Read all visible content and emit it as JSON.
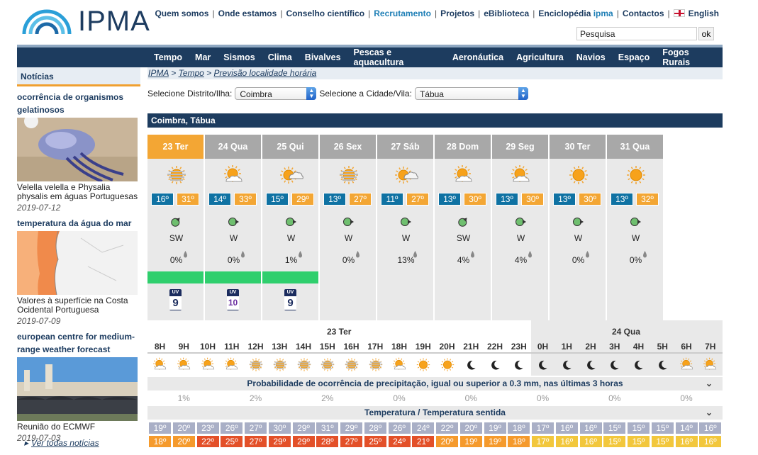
{
  "header": {
    "logo_text": "IPMA",
    "top_links": [
      "Quem somos",
      "Onde estamos",
      "Conselho científico",
      "Recrutamento",
      "Projetos",
      "eBiblioteca",
      "Enciclopédia ",
      "Contactos"
    ],
    "enciclopedia_suffix": "ipma",
    "english_label": "English",
    "search_placeholder": "Pesquisa",
    "search_value": "Pesquisa",
    "ok_label": "ok"
  },
  "main_nav": [
    "Tempo",
    "Mar",
    "Sismos",
    "Clima",
    "Bivalves",
    "Pescas e aquacultura",
    "Aeronáutica",
    "Agricultura",
    "Navios",
    "Espaço",
    "Fogos Rurais"
  ],
  "news": {
    "header": "Notícias",
    "items": [
      {
        "title": "ocorrência de organismos gelatinosos",
        "caption": "Velella velella e Physalia physalis em águas Portuguesas",
        "date": "2019-07-12"
      },
      {
        "title": "temperatura da água do mar",
        "caption": "Valores à superfície na Costa Ocidental Portuguesa",
        "date": "2019-07-09"
      },
      {
        "title": "european centre for medium-range weather forecast",
        "caption": "Reunião do ECMWF",
        "date": "2019-07-03"
      }
    ],
    "all_news": "Ver todas notícias"
  },
  "breadcrumb": {
    "ipma": "IPMA",
    "sep1": " > ",
    "tempo": "Tempo",
    "sep2": " > ",
    "current": "Previsão localidade horária"
  },
  "selectors": {
    "distrito_label": "Selecione Distrito/Ilha:",
    "distrito_value": "Coimbra",
    "cidade_label": "Selecione a Cidade/Vila:",
    "cidade_value": "Tábua"
  },
  "location_title": "Coimbra, Tábua",
  "days": [
    {
      "label": "23 Ter",
      "icon": "haze-sun",
      "tmin": "16º",
      "tmax": "31º",
      "wind": "SW",
      "prob": "0%",
      "green": true,
      "uv": "9",
      "uv_color": "#1b2c5e"
    },
    {
      "label": "24 Qua",
      "icon": "sun-cloud",
      "tmin": "14º",
      "tmax": "33º",
      "wind": "W",
      "prob": "0%",
      "green": true,
      "uv": "10",
      "uv_color": "#6b2fa0"
    },
    {
      "label": "25 Qui",
      "icon": "sun-cloud-big",
      "tmin": "15º",
      "tmax": "29º",
      "wind": "W",
      "prob": "1%",
      "green": true,
      "uv": "9",
      "uv_color": "#1b2c5e"
    },
    {
      "label": "26 Sex",
      "icon": "haze-sun",
      "tmin": "13º",
      "tmax": "27º",
      "wind": "W",
      "prob": "0%",
      "green": false,
      "uv": "",
      "uv_color": ""
    },
    {
      "label": "27 Sáb",
      "icon": "sun-cloud-big",
      "tmin": "11º",
      "tmax": "27º",
      "wind": "W",
      "prob": "13%",
      "green": false,
      "uv": "",
      "uv_color": ""
    },
    {
      "label": "28 Dom",
      "icon": "sun-cloud",
      "tmin": "13º",
      "tmax": "30º",
      "wind": "SW",
      "prob": "4%",
      "green": false,
      "uv": "",
      "uv_color": ""
    },
    {
      "label": "29 Seg",
      "icon": "sun-cloud",
      "tmin": "13º",
      "tmax": "30º",
      "wind": "W",
      "prob": "4%",
      "green": false,
      "uv": "",
      "uv_color": ""
    },
    {
      "label": "30 Ter",
      "icon": "sun",
      "tmin": "13º",
      "tmax": "30º",
      "wind": "W",
      "prob": "0%",
      "green": false,
      "uv": "",
      "uv_color": ""
    },
    {
      "label": "31 Qua",
      "icon": "sun",
      "tmin": "13º",
      "tmax": "32º",
      "wind": "W",
      "prob": "0%",
      "green": false,
      "uv": "",
      "uv_color": ""
    }
  ],
  "hourly": {
    "date1": "23 Ter",
    "date2": "24 Qua",
    "hours": [
      "8H",
      "9H",
      "10H",
      "11H",
      "12H",
      "13H",
      "14H",
      "15H",
      "16H",
      "17H",
      "18H",
      "19H",
      "20H",
      "21H",
      "22H",
      "23H",
      "0H",
      "1H",
      "2H",
      "3H",
      "4H",
      "5H",
      "6H",
      "7H"
    ],
    "icons": [
      "sun-cloud",
      "sun-cloud",
      "sun-cloud",
      "sun-cloud",
      "haze-sun",
      "haze-sun",
      "haze-sun",
      "haze-sun",
      "haze-sun",
      "haze-sun",
      "sun-cloud",
      "sun",
      "sun",
      "moon",
      "moon",
      "moon",
      "moon",
      "moon",
      "moon",
      "moon",
      "moon",
      "moon",
      "sun-cloud",
      "sun-cloud"
    ],
    "precip_title": "Probabilidade de ocorrência de precipitação, igual ou superior a 0.3 mm, nas últimas 3 horas",
    "precip": [
      {
        "col": 1,
        "v": "1%"
      },
      {
        "col": 4,
        "v": "2%"
      },
      {
        "col": 7,
        "v": "2%"
      },
      {
        "col": 10,
        "v": "0%"
      },
      {
        "col": 13,
        "v": "0%"
      },
      {
        "col": 16,
        "v": "0%"
      },
      {
        "col": 19,
        "v": "0%"
      },
      {
        "col": 22,
        "v": "0%"
      }
    ],
    "temp_title": "Temperatura / Temperatura sentida",
    "temps": [
      "19º",
      "20º",
      "23º",
      "26º",
      "27º",
      "30º",
      "29º",
      "31º",
      "29º",
      "28º",
      "26º",
      "24º",
      "22º",
      "20º",
      "19º",
      "18º",
      "17º",
      "16º",
      "16º",
      "15º",
      "15º",
      "15º",
      "14º",
      "16º"
    ],
    "temp_colors": [
      "g",
      "g",
      "g",
      "g",
      "g",
      "g",
      "g",
      "g",
      "g",
      "g",
      "g",
      "g",
      "g",
      "g",
      "g",
      "g",
      "g",
      "g",
      "g",
      "g",
      "g",
      "g",
      "g",
      "g"
    ],
    "feels": [
      "18º",
      "20º",
      "22º",
      "25º",
      "27º",
      "29º",
      "29º",
      "28º",
      "27º",
      "25º",
      "24º",
      "21º",
      "20º",
      "19º",
      "19º",
      "18º",
      "17º",
      "16º",
      "16º",
      "15º",
      "15º",
      "15º",
      "16º",
      "16º"
    ],
    "feels_colors": [
      "o",
      "o",
      "r",
      "r",
      "r",
      "r",
      "r",
      "r",
      "r",
      "r",
      "r",
      "r",
      "o",
      "o",
      "o",
      "o",
      "y",
      "y",
      "y",
      "y",
      "y",
      "y",
      "y",
      "y"
    ]
  },
  "colors": {
    "navy": "#1d3c5f",
    "orange": "#f3a634",
    "blue": "#0f72a3",
    "green": "#2fcf6d"
  }
}
